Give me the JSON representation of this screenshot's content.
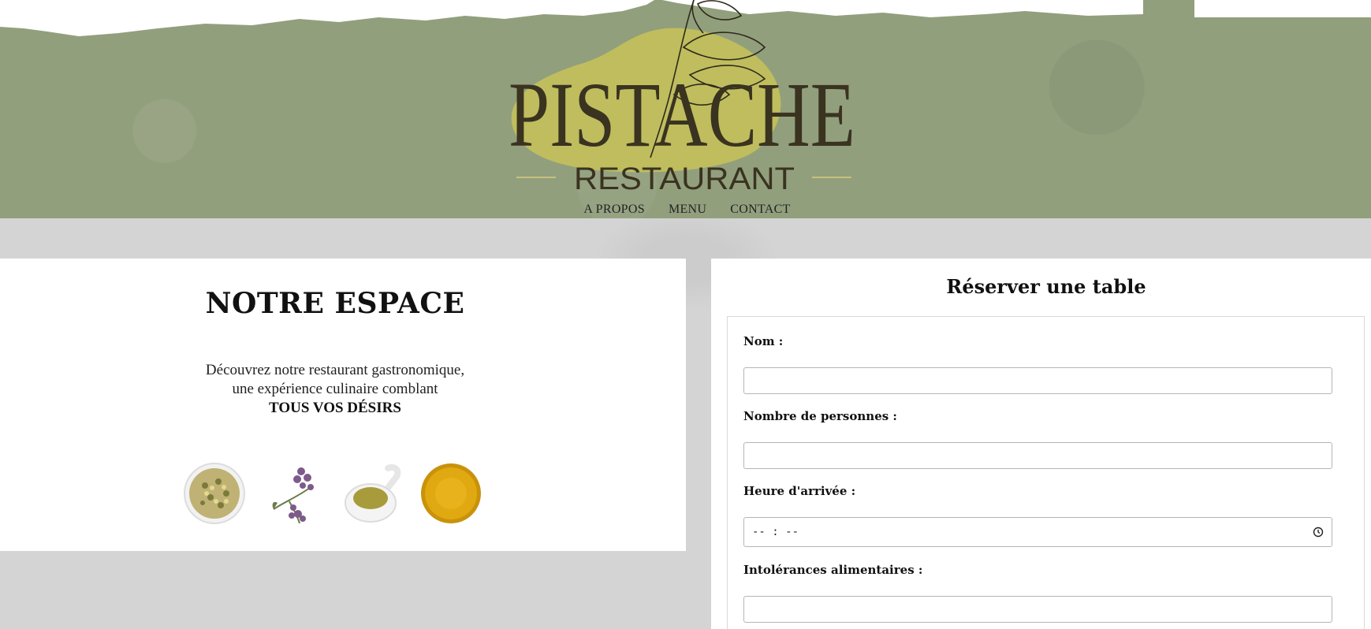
{
  "brand": {
    "name": "PISTACHE",
    "subtitle": "RESTAURANT"
  },
  "nav": {
    "items": [
      {
        "label": "A PROPOS"
      },
      {
        "label": "MENU"
      },
      {
        "label": "CONTACT"
      }
    ]
  },
  "espace": {
    "title": "NOTRE ESPACE",
    "line1": "Découvrez notre restaurant gastronomique,",
    "line2": "une expérience culinaire comblant",
    "line3": "TOUS VOS DÉSIRS",
    "ingredients": [
      {
        "icon": "chamomile-bowl-icon"
      },
      {
        "icon": "lavender-sprig-icon"
      },
      {
        "icon": "olive-oil-jug-icon"
      },
      {
        "icon": "turmeric-bowl-icon"
      }
    ]
  },
  "reservation": {
    "title": "Réserver une table",
    "fields": [
      {
        "label": "Nom :",
        "value": "",
        "placeholder": ""
      },
      {
        "label": "Nombre de personnes :",
        "value": "",
        "placeholder": ""
      },
      {
        "label": "Heure d'arrivée :",
        "value": "-- : --",
        "placeholder": ""
      },
      {
        "label": "Intolérances alimentaires :",
        "value": "",
        "placeholder": ""
      }
    ]
  },
  "colors": {
    "header_green": "#929f7d",
    "logo_text": "#3a3320",
    "logo_blob": "#c2bf5d",
    "background": "#d6d6d6"
  }
}
